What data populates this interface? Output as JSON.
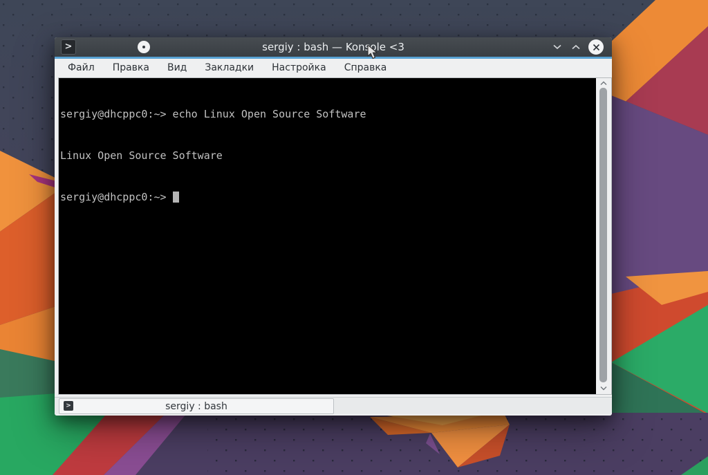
{
  "wallpaper": {
    "palette": [
      "#414a5c",
      "#4a4260",
      "#f0923d",
      "#dd5f2b",
      "#ea8434",
      "#28a861",
      "#3a7a5c",
      "#a83b52",
      "#674a80",
      "#cf4a2e",
      "#2bab67",
      "#4b3e62",
      "#ef8c38",
      "#bf3b3f",
      "#8a4d93"
    ]
  },
  "window": {
    "title": "sergiy : bash — Konsole <3",
    "app_icon_glyph": ">",
    "controls": {
      "minimize_icon": "chevron-down",
      "maximize_icon": "chevron-up",
      "close_icon": "circle-x"
    },
    "titlebar_color": "#3b4045",
    "accent_line_color": "#58a2d3"
  },
  "menubar": {
    "items": [
      "Файл",
      "Правка",
      "Вид",
      "Закладки",
      "Настройка",
      "Справка"
    ]
  },
  "terminal": {
    "bg": "#000000",
    "fg": "#c2c2c2",
    "lines": [
      "sergiy@dhcppc0:~> echo Linux Open Source Software",
      "Linux Open Source Software",
      "sergiy@dhcppc0:~>"
    ],
    "cursor_visible": true
  },
  "scrollbar": {
    "thumb_color": "#9ea2a6"
  },
  "tabbar": {
    "tabs": [
      {
        "icon_glyph": ">",
        "label": "sergiy : bash",
        "active": true
      }
    ]
  }
}
